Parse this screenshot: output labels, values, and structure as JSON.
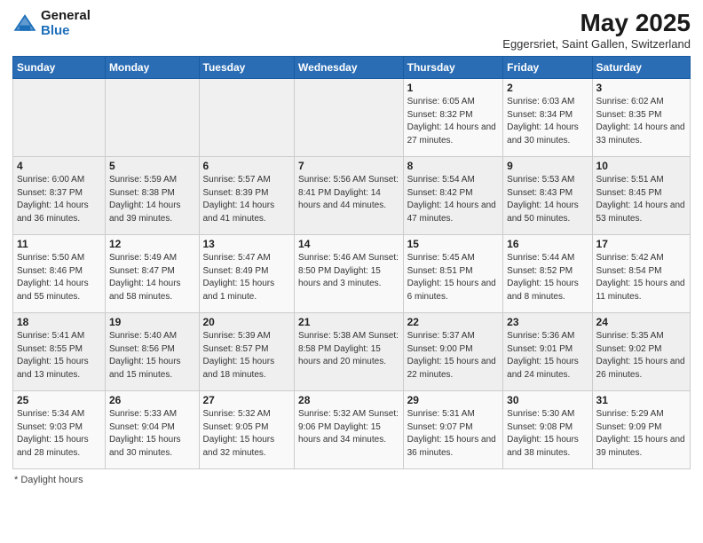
{
  "logo": {
    "general": "General",
    "blue": "Blue"
  },
  "title": "May 2025",
  "subtitle": "Eggersriet, Saint Gallen, Switzerland",
  "days_of_week": [
    "Sunday",
    "Monday",
    "Tuesday",
    "Wednesday",
    "Thursday",
    "Friday",
    "Saturday"
  ],
  "weeks": [
    [
      {
        "day": "",
        "info": ""
      },
      {
        "day": "",
        "info": ""
      },
      {
        "day": "",
        "info": ""
      },
      {
        "day": "",
        "info": ""
      },
      {
        "day": "1",
        "info": "Sunrise: 6:05 AM\nSunset: 8:32 PM\nDaylight: 14 hours\nand 27 minutes."
      },
      {
        "day": "2",
        "info": "Sunrise: 6:03 AM\nSunset: 8:34 PM\nDaylight: 14 hours\nand 30 minutes."
      },
      {
        "day": "3",
        "info": "Sunrise: 6:02 AM\nSunset: 8:35 PM\nDaylight: 14 hours\nand 33 minutes."
      }
    ],
    [
      {
        "day": "4",
        "info": "Sunrise: 6:00 AM\nSunset: 8:37 PM\nDaylight: 14 hours\nand 36 minutes."
      },
      {
        "day": "5",
        "info": "Sunrise: 5:59 AM\nSunset: 8:38 PM\nDaylight: 14 hours\nand 39 minutes."
      },
      {
        "day": "6",
        "info": "Sunrise: 5:57 AM\nSunset: 8:39 PM\nDaylight: 14 hours\nand 41 minutes."
      },
      {
        "day": "7",
        "info": "Sunrise: 5:56 AM\nSunset: 8:41 PM\nDaylight: 14 hours\nand 44 minutes."
      },
      {
        "day": "8",
        "info": "Sunrise: 5:54 AM\nSunset: 8:42 PM\nDaylight: 14 hours\nand 47 minutes."
      },
      {
        "day": "9",
        "info": "Sunrise: 5:53 AM\nSunset: 8:43 PM\nDaylight: 14 hours\nand 50 minutes."
      },
      {
        "day": "10",
        "info": "Sunrise: 5:51 AM\nSunset: 8:45 PM\nDaylight: 14 hours\nand 53 minutes."
      }
    ],
    [
      {
        "day": "11",
        "info": "Sunrise: 5:50 AM\nSunset: 8:46 PM\nDaylight: 14 hours\nand 55 minutes."
      },
      {
        "day": "12",
        "info": "Sunrise: 5:49 AM\nSunset: 8:47 PM\nDaylight: 14 hours\nand 58 minutes."
      },
      {
        "day": "13",
        "info": "Sunrise: 5:47 AM\nSunset: 8:49 PM\nDaylight: 15 hours\nand 1 minute."
      },
      {
        "day": "14",
        "info": "Sunrise: 5:46 AM\nSunset: 8:50 PM\nDaylight: 15 hours\nand 3 minutes."
      },
      {
        "day": "15",
        "info": "Sunrise: 5:45 AM\nSunset: 8:51 PM\nDaylight: 15 hours\nand 6 minutes."
      },
      {
        "day": "16",
        "info": "Sunrise: 5:44 AM\nSunset: 8:52 PM\nDaylight: 15 hours\nand 8 minutes."
      },
      {
        "day": "17",
        "info": "Sunrise: 5:42 AM\nSunset: 8:54 PM\nDaylight: 15 hours\nand 11 minutes."
      }
    ],
    [
      {
        "day": "18",
        "info": "Sunrise: 5:41 AM\nSunset: 8:55 PM\nDaylight: 15 hours\nand 13 minutes."
      },
      {
        "day": "19",
        "info": "Sunrise: 5:40 AM\nSunset: 8:56 PM\nDaylight: 15 hours\nand 15 minutes."
      },
      {
        "day": "20",
        "info": "Sunrise: 5:39 AM\nSunset: 8:57 PM\nDaylight: 15 hours\nand 18 minutes."
      },
      {
        "day": "21",
        "info": "Sunrise: 5:38 AM\nSunset: 8:58 PM\nDaylight: 15 hours\nand 20 minutes."
      },
      {
        "day": "22",
        "info": "Sunrise: 5:37 AM\nSunset: 9:00 PM\nDaylight: 15 hours\nand 22 minutes."
      },
      {
        "day": "23",
        "info": "Sunrise: 5:36 AM\nSunset: 9:01 PM\nDaylight: 15 hours\nand 24 minutes."
      },
      {
        "day": "24",
        "info": "Sunrise: 5:35 AM\nSunset: 9:02 PM\nDaylight: 15 hours\nand 26 minutes."
      }
    ],
    [
      {
        "day": "25",
        "info": "Sunrise: 5:34 AM\nSunset: 9:03 PM\nDaylight: 15 hours\nand 28 minutes."
      },
      {
        "day": "26",
        "info": "Sunrise: 5:33 AM\nSunset: 9:04 PM\nDaylight: 15 hours\nand 30 minutes."
      },
      {
        "day": "27",
        "info": "Sunrise: 5:32 AM\nSunset: 9:05 PM\nDaylight: 15 hours\nand 32 minutes."
      },
      {
        "day": "28",
        "info": "Sunrise: 5:32 AM\nSunset: 9:06 PM\nDaylight: 15 hours\nand 34 minutes."
      },
      {
        "day": "29",
        "info": "Sunrise: 5:31 AM\nSunset: 9:07 PM\nDaylight: 15 hours\nand 36 minutes."
      },
      {
        "day": "30",
        "info": "Sunrise: 5:30 AM\nSunset: 9:08 PM\nDaylight: 15 hours\nand 38 minutes."
      },
      {
        "day": "31",
        "info": "Sunrise: 5:29 AM\nSunset: 9:09 PM\nDaylight: 15 hours\nand 39 minutes."
      }
    ]
  ],
  "footer": "Daylight hours"
}
